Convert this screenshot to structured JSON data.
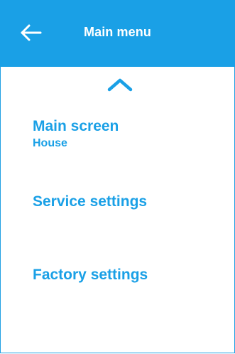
{
  "header": {
    "title": "Main menu",
    "back_icon": "back-arrow-icon",
    "background": "#1aa0e6",
    "text_color": "#ffffff"
  },
  "scroll_up_icon": "chevron-up-icon",
  "accent_color": "#1aa0e6",
  "menu": {
    "items": [
      {
        "label": "Main screen",
        "sublabel": "House"
      },
      {
        "label": "Service settings"
      },
      {
        "label": "Factory settings"
      }
    ]
  }
}
